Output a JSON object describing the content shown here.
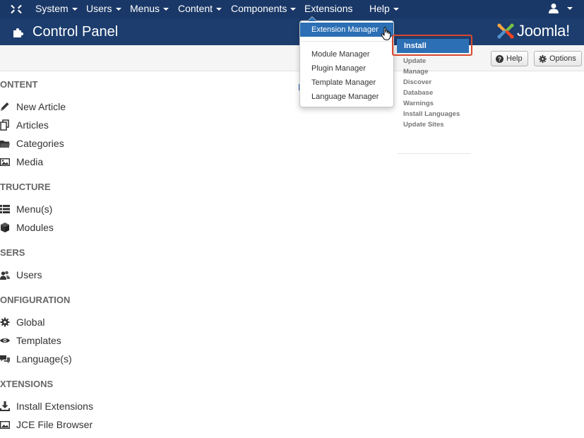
{
  "navbar": {
    "menus": [
      {
        "label": "System",
        "has_caret": true
      },
      {
        "label": "Users",
        "has_caret": true
      },
      {
        "label": "Menus",
        "has_caret": true
      },
      {
        "label": "Content",
        "has_caret": true
      },
      {
        "label": "Components",
        "has_caret": true
      },
      {
        "label": "Extensions",
        "has_caret": false
      },
      {
        "label": "Help",
        "has_caret": true
      }
    ],
    "logo_icon": "joomla-x-icon",
    "user_icon": "user-icon"
  },
  "header": {
    "title": "Control Panel",
    "title_icon": "puzzle-icon",
    "brand": "Joomla!"
  },
  "toolbar": {
    "help_label": "Help",
    "options_label": "Options"
  },
  "sidebar": {
    "sections": [
      {
        "title": "ONTENT",
        "items": [
          {
            "label": "New Article",
            "icon": "pencil-icon"
          },
          {
            "label": "Articles",
            "icon": "copy-icon"
          },
          {
            "label": "Categories",
            "icon": "folder-icon"
          },
          {
            "label": "Media",
            "icon": "image-icon"
          }
        ]
      },
      {
        "title": "TRUCTURE",
        "items": [
          {
            "label": "Menu(s)",
            "icon": "list-icon"
          },
          {
            "label": "Modules",
            "icon": "cube-icon"
          }
        ]
      },
      {
        "title": "SERS",
        "items": [
          {
            "label": "Users",
            "icon": "users-icon"
          }
        ]
      },
      {
        "title": "ONFIGURATION",
        "items": [
          {
            "label": "Global",
            "icon": "gear-icon"
          },
          {
            "label": "Templates",
            "icon": "eye-icon"
          },
          {
            "label": "Language(s)",
            "icon": "comments-icon"
          }
        ]
      },
      {
        "title": "XTENSIONS",
        "items": [
          {
            "label": "Install Extensions",
            "icon": "download-icon"
          },
          {
            "label": "JCE File Browser",
            "icon": "image-icon"
          }
        ]
      }
    ]
  },
  "extensions_menu": {
    "items": [
      {
        "label": "Extension Manager",
        "highlighted": true
      },
      {
        "label": "Module Manager",
        "highlighted": false
      },
      {
        "label": "Plugin Manager",
        "highlighted": false
      },
      {
        "label": "Template Manager",
        "highlighted": false
      },
      {
        "label": "Language Manager",
        "highlighted": false
      }
    ]
  },
  "extension_manager_submenu": {
    "active": "Install",
    "links": [
      "Update",
      "Manage",
      "Discover",
      "Database",
      "Warnings",
      "Install Languages",
      "Update Sites"
    ]
  },
  "colors": {
    "navbar": "#1a3867",
    "header": "#1c3d6e",
    "highlight": "#2c6fb4",
    "callout": "#d9482e"
  }
}
